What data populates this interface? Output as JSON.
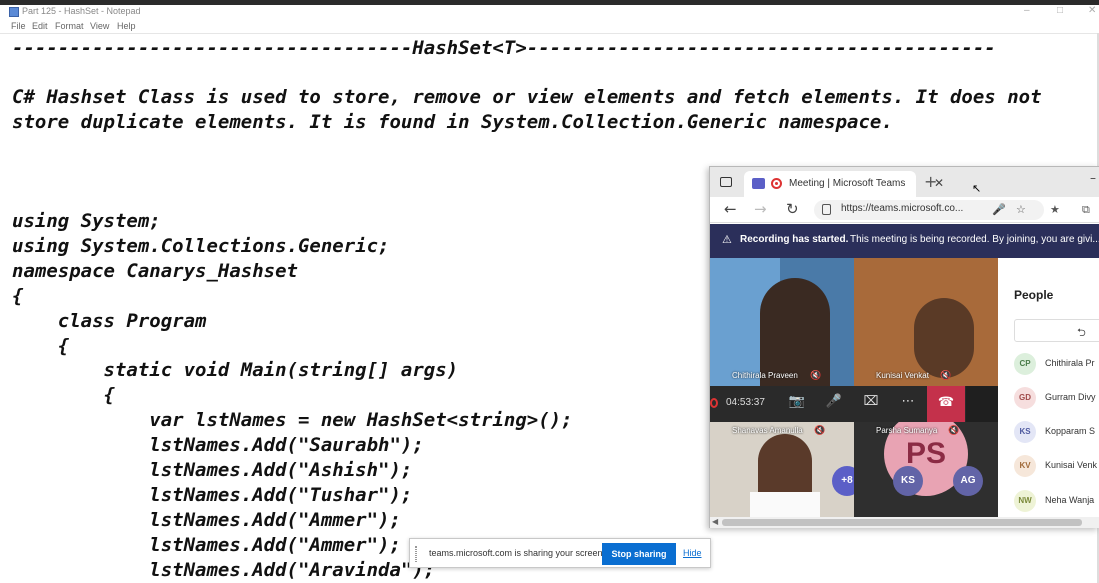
{
  "window": {
    "title": "Part 125 - HashSet - Notepad",
    "controls": [
      "–",
      "□",
      "✕"
    ]
  },
  "menu": [
    "File",
    "Edit",
    "Format",
    "View",
    "Help"
  ],
  "editor": {
    "lines": [
      "-----------------------------------HashSet<T>-----------------------------------------",
      "",
      "C# Hashset Class is used to store, remove or view elements and fetch elements. It does not",
      "store duplicate elements. It is found in System.Collection.Generic namespace.",
      "",
      "",
      "using System;",
      "using System.Collections.Generic;",
      "namespace Canarys_Hashset",
      "{",
      "    class Program",
      "    {",
      "        static void Main(string[] args)",
      "        {",
      "            var lstNames = new HashSet<string>();",
      "            lstNames.Add(\"Saurabh\");",
      "            lstNames.Add(\"Ashish\");",
      "            lstNames.Add(\"Tushar\");",
      "            lstNames.Add(\"Ammer\");",
      "            lstNames.Add(\"Ammer\");",
      "            lstNames.Add(\"Aravinda\");"
    ]
  },
  "browser": {
    "tab_title": "Meeting | Microsoft Teams",
    "tab_close": "✕",
    "new_tab": "+",
    "url": "https://teams.microsoft.co...",
    "recording_title": "Recording has started.",
    "recording_text": "This meeting is being recorded. By joining, you are givi..."
  },
  "meeting": {
    "timer": "04:53:37",
    "participants_video": [
      {
        "name": "Chithirala Praveen"
      },
      {
        "name": "Kunisai Venkat"
      },
      {
        "name": "Shanavas Amanulla"
      },
      {
        "name": "Parsha Sumanya"
      }
    ],
    "avatars": [
      {
        "initials": "PS",
        "color": "#e8a3b3"
      },
      {
        "initials": "+8",
        "color": "#5b5fc7"
      },
      {
        "initials": "KS",
        "color": "#6264a7"
      },
      {
        "initials": "AG",
        "color": "#6264a7"
      }
    ]
  },
  "people": {
    "title": "People",
    "list": [
      {
        "initials": "CP",
        "name": "Chithirala Pr",
        "bg": "#dcefdc",
        "fg": "#4a7d4a"
      },
      {
        "initials": "GD",
        "name": "Gurram Divy",
        "bg": "#f6dede",
        "fg": "#a04a4a"
      },
      {
        "initials": "KS",
        "name": "Kopparam S",
        "bg": "#e3e6f6",
        "fg": "#4f5aa0"
      },
      {
        "initials": "KV",
        "name": "Kunisai Venk",
        "bg": "#f6e7da",
        "fg": "#a06a3a"
      },
      {
        "initials": "NW",
        "name": "Neha Wanja",
        "bg": "#eef3d6",
        "fg": "#7b8a3a"
      }
    ]
  },
  "sharing": {
    "text": "teams.microsoft.com is sharing your screen.",
    "stop_label": "Stop sharing",
    "hide_label": "Hide"
  }
}
